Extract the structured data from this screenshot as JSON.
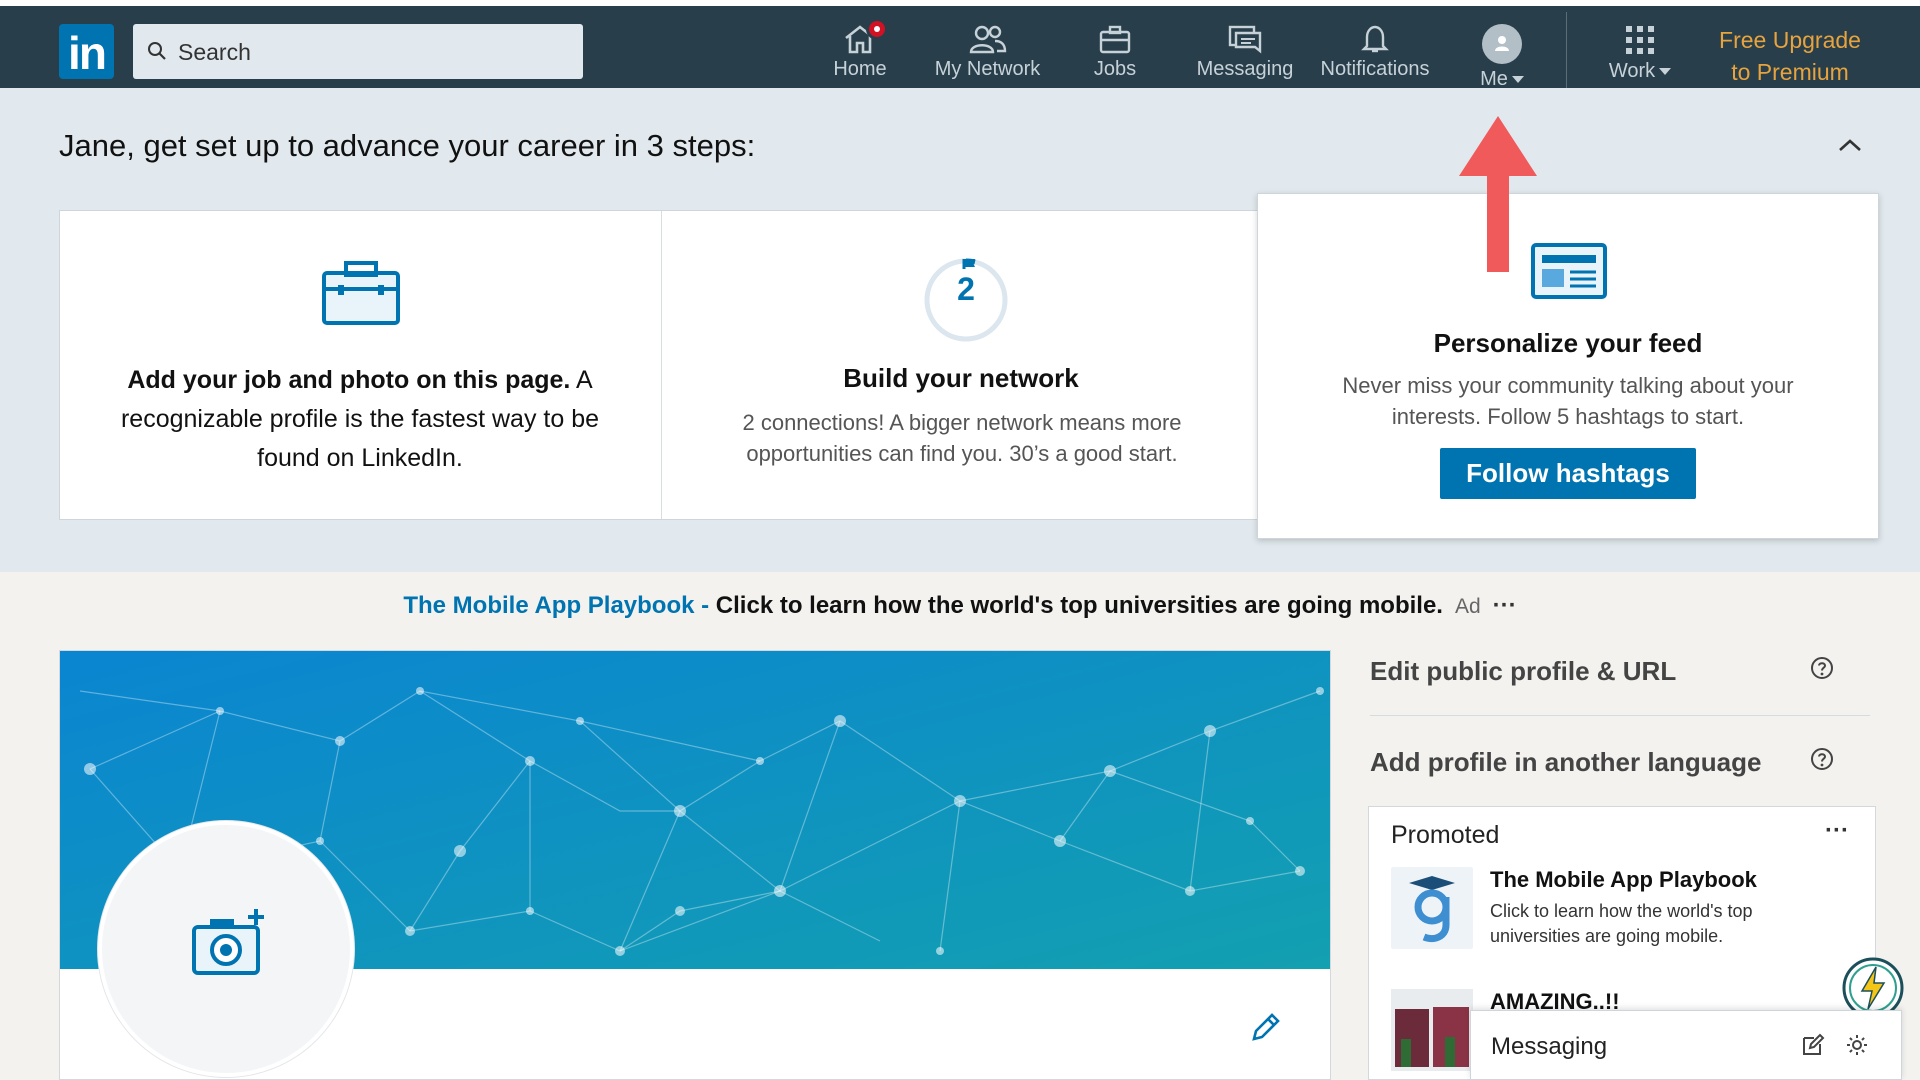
{
  "nav": {
    "logo": "in",
    "search_placeholder": "Search",
    "items": [
      {
        "label": "Home",
        "icon": "home-icon"
      },
      {
        "label": "My Network",
        "icon": "network-icon"
      },
      {
        "label": "Jobs",
        "icon": "briefcase-icon"
      },
      {
        "label": "Messaging",
        "icon": "messaging-icon"
      },
      {
        "label": "Notifications",
        "icon": "bell-icon"
      },
      {
        "label": "Me",
        "icon": "avatar"
      },
      {
        "label": "Work",
        "icon": "grid-icon"
      }
    ],
    "premium_line1": "Free Upgrade",
    "premium_line2": "to Premium",
    "colors": {
      "bar": "#283e4a",
      "premium": "#e7a33e",
      "notification": "#d11124"
    }
  },
  "setup": {
    "title": "Jane, get set up to advance your career in 3 steps:",
    "card1": {
      "bold": "Add your job and photo on this page.",
      "text": " A recognizable profile is the fastest way to be found on LinkedIn."
    },
    "card2": {
      "progress": "2",
      "title": "Build your network",
      "desc": "2 connections! A bigger network means more opportunities can find you. 30’s a good start."
    },
    "card3": {
      "title": "Personalize your feed",
      "desc": "Never miss your community talking about your interests. Follow 5 hashtags to start.",
      "button": "Follow hashtags"
    }
  },
  "ad": {
    "link": "The Mobile App Playbook -",
    "text": " Click to learn how the world's top universities are going mobile.",
    "tag": "Ad",
    "more": "···"
  },
  "rail": {
    "edit_profile": "Edit public profile & URL",
    "add_language": "Add profile in another language",
    "promoted": {
      "header": "Promoted",
      "more": "···",
      "item1_title": "The Mobile App Playbook",
      "item1_desc": "Click to learn how the world's top universities are going mobile.",
      "item2_title": "AMAZING..!!"
    }
  },
  "messaging": {
    "label": "Messaging"
  }
}
